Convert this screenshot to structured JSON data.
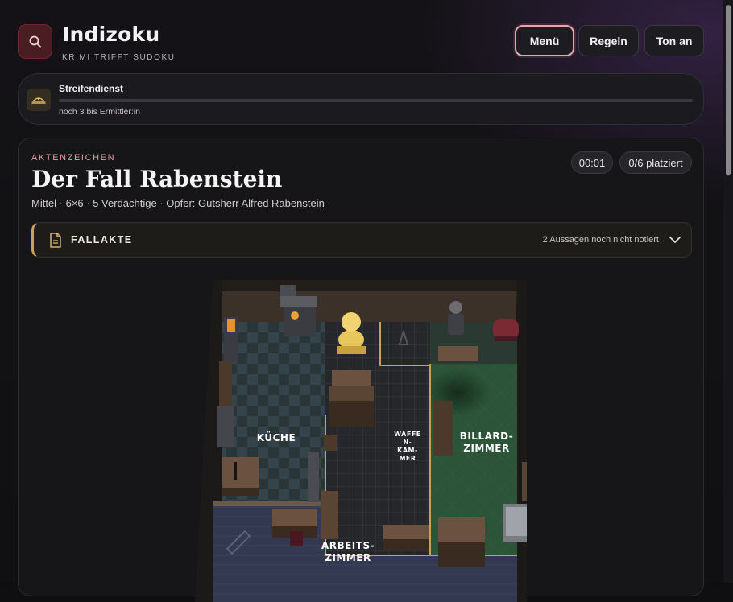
{
  "app": {
    "title": "Indizoku",
    "subtitle": "KRIMI TRIFFT SUDOKU"
  },
  "nav": {
    "menu_label": "Menü",
    "rules_label": "Regeln",
    "sound_label": "Ton an"
  },
  "rank": {
    "title": "Streifendienst",
    "progress_fraction": 0.0,
    "next_text": "noch 3 bis Ermittler:in"
  },
  "case": {
    "file_label": "AKTENZEICHEN",
    "title": "Der Fall Rabenstein",
    "meta": "Mittel · 6×6 · 5 Verdächtige · Opfer: Gutsherr Alfred Rabenstein",
    "timer": "00:01",
    "placed": "0/6 platziert"
  },
  "casefile": {
    "label": "FALLAKTE",
    "note": "2 Aussagen noch nicht notiert"
  },
  "board": {
    "rooms": [
      {
        "id": "kueche",
        "lines": [
          "KÜCHE"
        ]
      },
      {
        "id": "waffenkammer",
        "lines": [
          "WAFFE",
          "N-",
          "KAM-",
          "MER"
        ]
      },
      {
        "id": "billardzimmer",
        "lines": [
          "BILLARD-",
          "ZIMMER"
        ]
      },
      {
        "id": "arbeitszimmer",
        "lines": [
          "ARBEITS-",
          "ZIMMER"
        ]
      }
    ]
  },
  "colors": {
    "accent_pink": "#e6a7ac",
    "accent_gold": "#c9a25a",
    "kitchen_floor": "#2c3a3d",
    "armory_floor": "#2a2c30",
    "billiard_felt": "#2e5a3c",
    "study_floor": "#333a52"
  },
  "icons": {
    "logo": "search-icon",
    "rank": "police-cap-icon",
    "casefile": "document-icon",
    "expand": "chevron-down-icon"
  }
}
